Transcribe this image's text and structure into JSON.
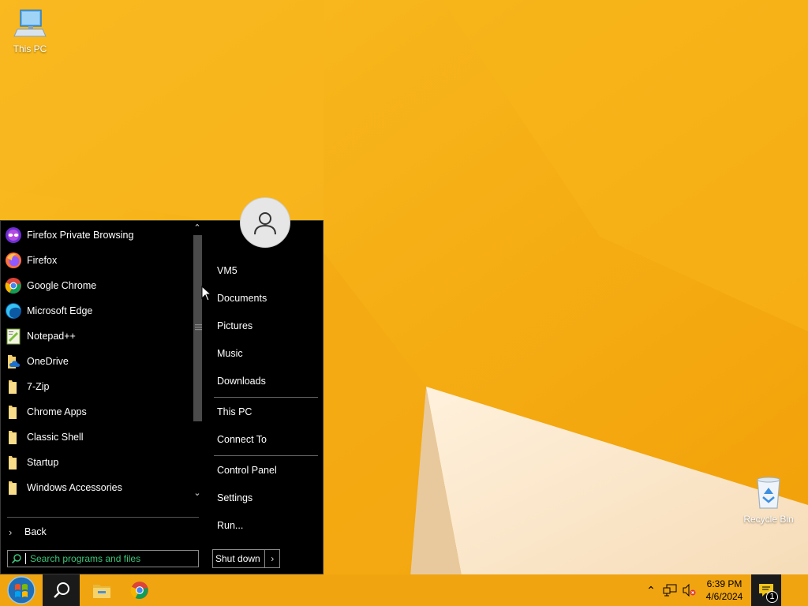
{
  "desktop": {
    "icons": [
      {
        "label": "This PC"
      },
      {
        "label": "Recycle Bin"
      }
    ]
  },
  "start_menu": {
    "programs": [
      {
        "label": "Firefox Private Browsing",
        "icon": "firefox-private-icon"
      },
      {
        "label": "Firefox",
        "icon": "firefox-icon"
      },
      {
        "label": "Google Chrome",
        "icon": "chrome-icon"
      },
      {
        "label": "Microsoft Edge",
        "icon": "edge-icon"
      },
      {
        "label": "Notepad++",
        "icon": "notepadpp-icon"
      },
      {
        "label": "OneDrive",
        "icon": "onedrive-folder-icon"
      },
      {
        "label": "7-Zip",
        "icon": "folder-icon"
      },
      {
        "label": "Chrome Apps",
        "icon": "folder-icon"
      },
      {
        "label": "Classic Shell",
        "icon": "folder-icon"
      },
      {
        "label": "Startup",
        "icon": "folder-icon"
      },
      {
        "label": "Windows Accessories",
        "icon": "folder-icon"
      }
    ],
    "back_label": "Back",
    "search_placeholder": "Search programs and files",
    "right_items": {
      "user": "VM5",
      "documents": "Documents",
      "pictures": "Pictures",
      "music": "Music",
      "downloads": "Downloads",
      "this_pc": "This PC",
      "connect_to": "Connect To",
      "control_panel": "Control Panel",
      "settings": "Settings",
      "run": "Run..."
    },
    "shutdown_label": "Shut down"
  },
  "taskbar": {
    "clock_time": "6:39 PM",
    "clock_date": "4/6/2024",
    "notification_count": "1"
  },
  "colors": {
    "accent": "#f0a410",
    "menu_bg": "#000000",
    "search_text": "#3cc47a"
  }
}
